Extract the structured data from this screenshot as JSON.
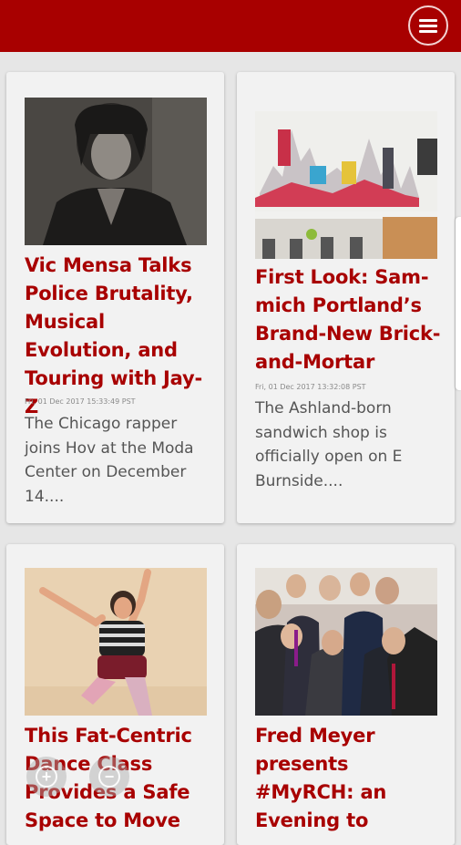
{
  "header": {
    "menu_icon": "hamburger-menu-icon",
    "brand_color": "#a80000"
  },
  "articles": [
    {
      "title": "Vic Mensa Talks Police Brutality, Musical Evolution, and Touring with Jay-Z",
      "date": "Fri, 01 Dec 2017 15:33:49 PST",
      "excerpt": "The Chicago rapper joins Hov at the Moda Center on December 14...."
    },
    {
      "title": "First Look: Sam-mich Portland’s Brand-New Brick-and-Mortar",
      "date": "Fri, 01 Dec 2017 13:32:08 PST",
      "excerpt": "The Ashland-born sandwich shop is officially open on E Burnside...."
    },
    {
      "title": "This Fat-Centric Dance Class Provides a Safe Space to Move",
      "date": "",
      "excerpt": ""
    },
    {
      "title": "Fred Meyer presents #MyRCH: an Evening to",
      "date": "",
      "excerpt": ""
    }
  ],
  "controls": {
    "zoom_in_icon": "zoom-in-icon",
    "zoom_out_icon": "zoom-out-icon"
  }
}
